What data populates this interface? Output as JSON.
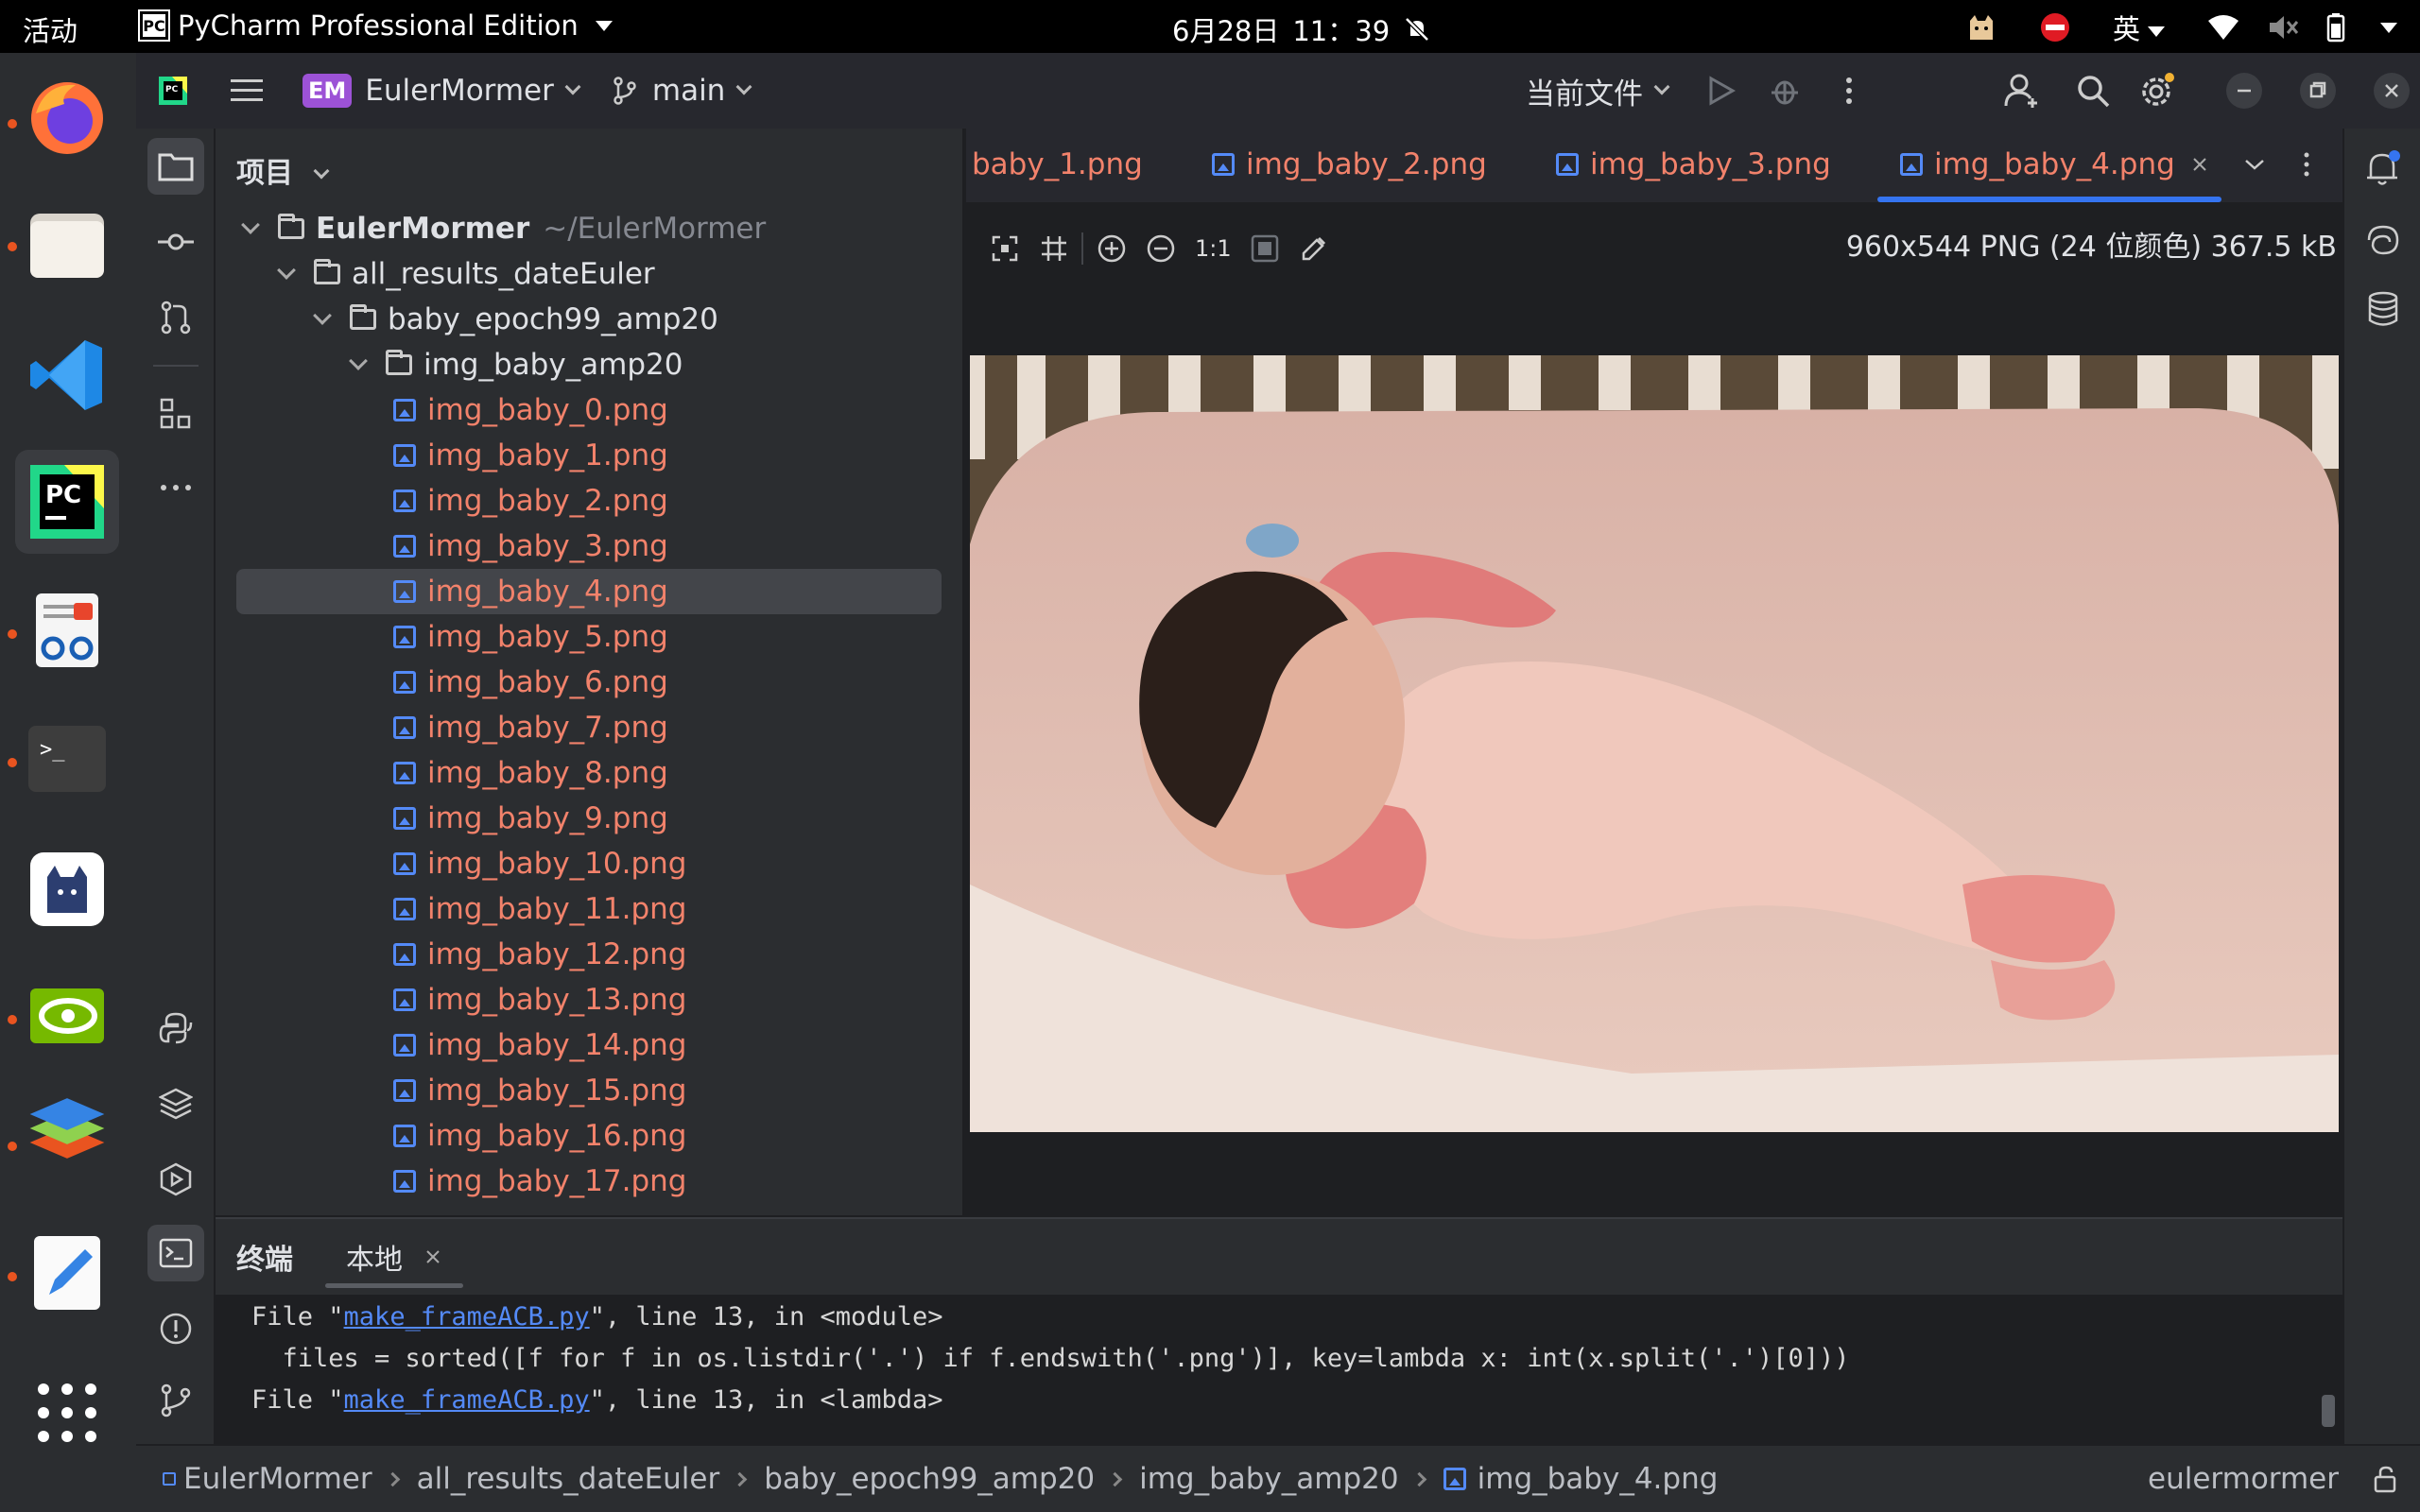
{
  "system": {
    "activities": "活动",
    "app_menu": "PyCharm Professional Edition",
    "date": "6月28日",
    "time": "11：39",
    "input_method": "英"
  },
  "ide": {
    "project_badge": "EM",
    "project_name": "EulerMormer",
    "branch": "main",
    "run_config": "当前文件"
  },
  "project_panel": {
    "title": "项目",
    "root_name": "EulerMormer",
    "root_path": "~/EulerMormer",
    "folders": [
      "all_results_dateEuler",
      "baby_epoch99_amp20",
      "img_baby_amp20"
    ],
    "files": [
      "img_baby_0.png",
      "img_baby_1.png",
      "img_baby_2.png",
      "img_baby_3.png",
      "img_baby_4.png",
      "img_baby_5.png",
      "img_baby_6.png",
      "img_baby_7.png",
      "img_baby_8.png",
      "img_baby_9.png",
      "img_baby_10.png",
      "img_baby_11.png",
      "img_baby_12.png",
      "img_baby_13.png",
      "img_baby_14.png",
      "img_baby_15.png",
      "img_baby_16.png",
      "img_baby_17.png"
    ],
    "selected": "img_baby_4.png"
  },
  "editor": {
    "tabs": [
      "baby_1.png",
      "img_baby_2.png",
      "img_baby_3.png",
      "img_baby_4.png"
    ],
    "active_tab": "img_baby_4.png",
    "zoom_label": "1:1",
    "image_info": "960x544 PNG (24 位颜色) 367.5 kB"
  },
  "terminal": {
    "title": "终端",
    "tab": "本地",
    "lines": [
      {
        "prefix": "File \"",
        "link": "make_frameACB.py",
        "suffix": "\", line 13, in <module>"
      },
      {
        "text": "  files = sorted([f for f in os.listdir('.') if f.endswith('.png')], key=lambda x: int(x.split('.')[0]))"
      },
      {
        "prefix": "File \"",
        "link": "make_frameACB.py",
        "suffix": "\", line 13, in <lambda>"
      }
    ]
  },
  "statusbar": {
    "breadcrumbs": [
      "EulerMormer",
      "all_results_dateEuler",
      "baby_epoch99_amp20",
      "img_baby_amp20",
      "img_baby_4.png"
    ],
    "user": "eulermormer"
  },
  "colors": {
    "accent": "#3574f0",
    "file_modified": "#f2826b",
    "link": "#548af7",
    "brand_badge": "#9c52d6"
  }
}
